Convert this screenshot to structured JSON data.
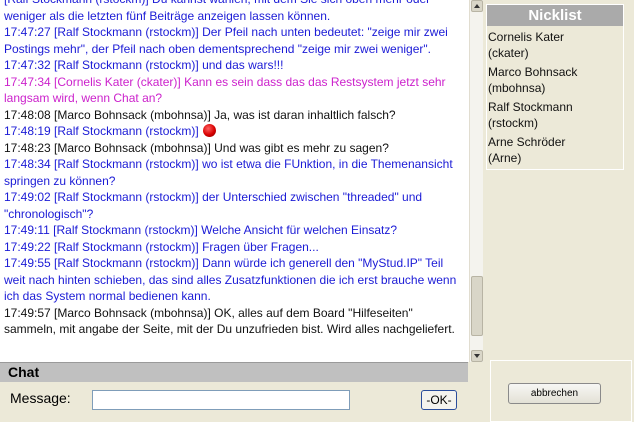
{
  "messages": [
    {
      "color": "blue",
      "text": "[Ralf Stockmann (rstockm)] Du kannst wählen, mit dem Sie sich oben mehr oder weniger als die letzten fünf Beiträge anzeigen lassen können."
    },
    {
      "color": "blue",
      "text": "17:47:27 [Ralf Stockmann (rstockm)] Der Pfeil nach unten bedeutet: \"zeige mir zwei Postings mehr\", der Pfeil nach oben dementsprechend \"zeige mir zwei weniger\"."
    },
    {
      "color": "blue",
      "text": "17:47:32 [Ralf Stockmann (rstockm)] und das wars!!!"
    },
    {
      "color": "magenta",
      "text": "17:47:34 [Cornelis Kater (ckater)] Kann es sein dass das das Restsystem jetzt sehr langsam wird, wenn Chat an?"
    },
    {
      "color": "black",
      "text": "17:48:08 [Marco Bohnsack (mbohnsa)] Ja, was ist daran inhaltlich falsch?"
    },
    {
      "color": "blue",
      "text": "17:48:19 [Ralf Stockmann (rstockm)]",
      "icon": "red-ball-icon"
    },
    {
      "color": "black",
      "text": "17:48:23 [Marco Bohnsack (mbohnsa)] Und was gibt es mehr zu sagen?"
    },
    {
      "color": "blue",
      "text": "17:48:34 [Ralf Stockmann (rstockm)] wo ist etwa die FUnktion, in die Themenansicht springen zu können?"
    },
    {
      "color": "blue",
      "text": "17:49:02 [Ralf Stockmann (rstockm)] der Unterschied zwischen \"threaded\" und \"chronologisch\"?"
    },
    {
      "color": "blue",
      "text": "17:49:11 [Ralf Stockmann (rstockm)] Welche Ansicht für welchen Einsatz?"
    },
    {
      "color": "blue",
      "text": "17:49:22 [Ralf Stockmann (rstockm)] Fragen über Fragen..."
    },
    {
      "color": "blue",
      "text": "17:49:55 [Ralf Stockmann (rstockm)] Dann würde ich generell den \"MyStud.IP\" Teil weit nach hinten schieben, das sind alles Zusatzfunktionen die ich erst brauche wenn ich das System normal bedienen kann."
    },
    {
      "color": "black",
      "text": "17:49:57 [Marco Bohnsack (mbohnsa)] OK, alles auf dem Board \"Hilfeseiten\" sammeln, mit angabe der Seite, mit der Du unzufrieden bist. Wird alles nachgeliefert."
    }
  ],
  "colors": {
    "blue": "#1b1bd6",
    "black": "#111111",
    "magenta": "#cc22cc"
  },
  "chat": {
    "title": "Chat",
    "message_label": "Message:",
    "message_value": "",
    "ok_label": "-OK-"
  },
  "nicklist": {
    "title": "Nicklist",
    "nicks": [
      "Cornelis Kater",
      "(ckater)",
      "Marco Bohnsack",
      "(mbohnsa)",
      "Ralf Stockmann",
      "(rstockm)",
      "Arne Schröder",
      "(Arne)"
    ]
  },
  "abort_label": "abbrechen"
}
